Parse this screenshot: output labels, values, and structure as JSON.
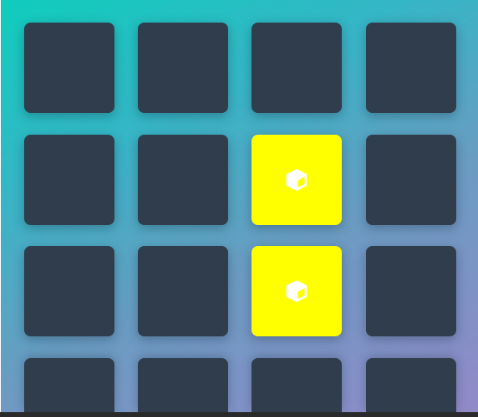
{
  "colors": {
    "card_back": "#2f3d4c",
    "card_flipped": "#ffff00",
    "icon": "#ffffff"
  },
  "cards": [
    {
      "flipped": false
    },
    {
      "flipped": false
    },
    {
      "flipped": false
    },
    {
      "flipped": false
    },
    {
      "flipped": false
    },
    {
      "flipped": false
    },
    {
      "flipped": true,
      "icon": "cube-icon"
    },
    {
      "flipped": false
    },
    {
      "flipped": false
    },
    {
      "flipped": false
    },
    {
      "flipped": true,
      "icon": "cube-icon"
    },
    {
      "flipped": false
    },
    {
      "flipped": false
    },
    {
      "flipped": false
    },
    {
      "flipped": false
    },
    {
      "flipped": false
    }
  ]
}
